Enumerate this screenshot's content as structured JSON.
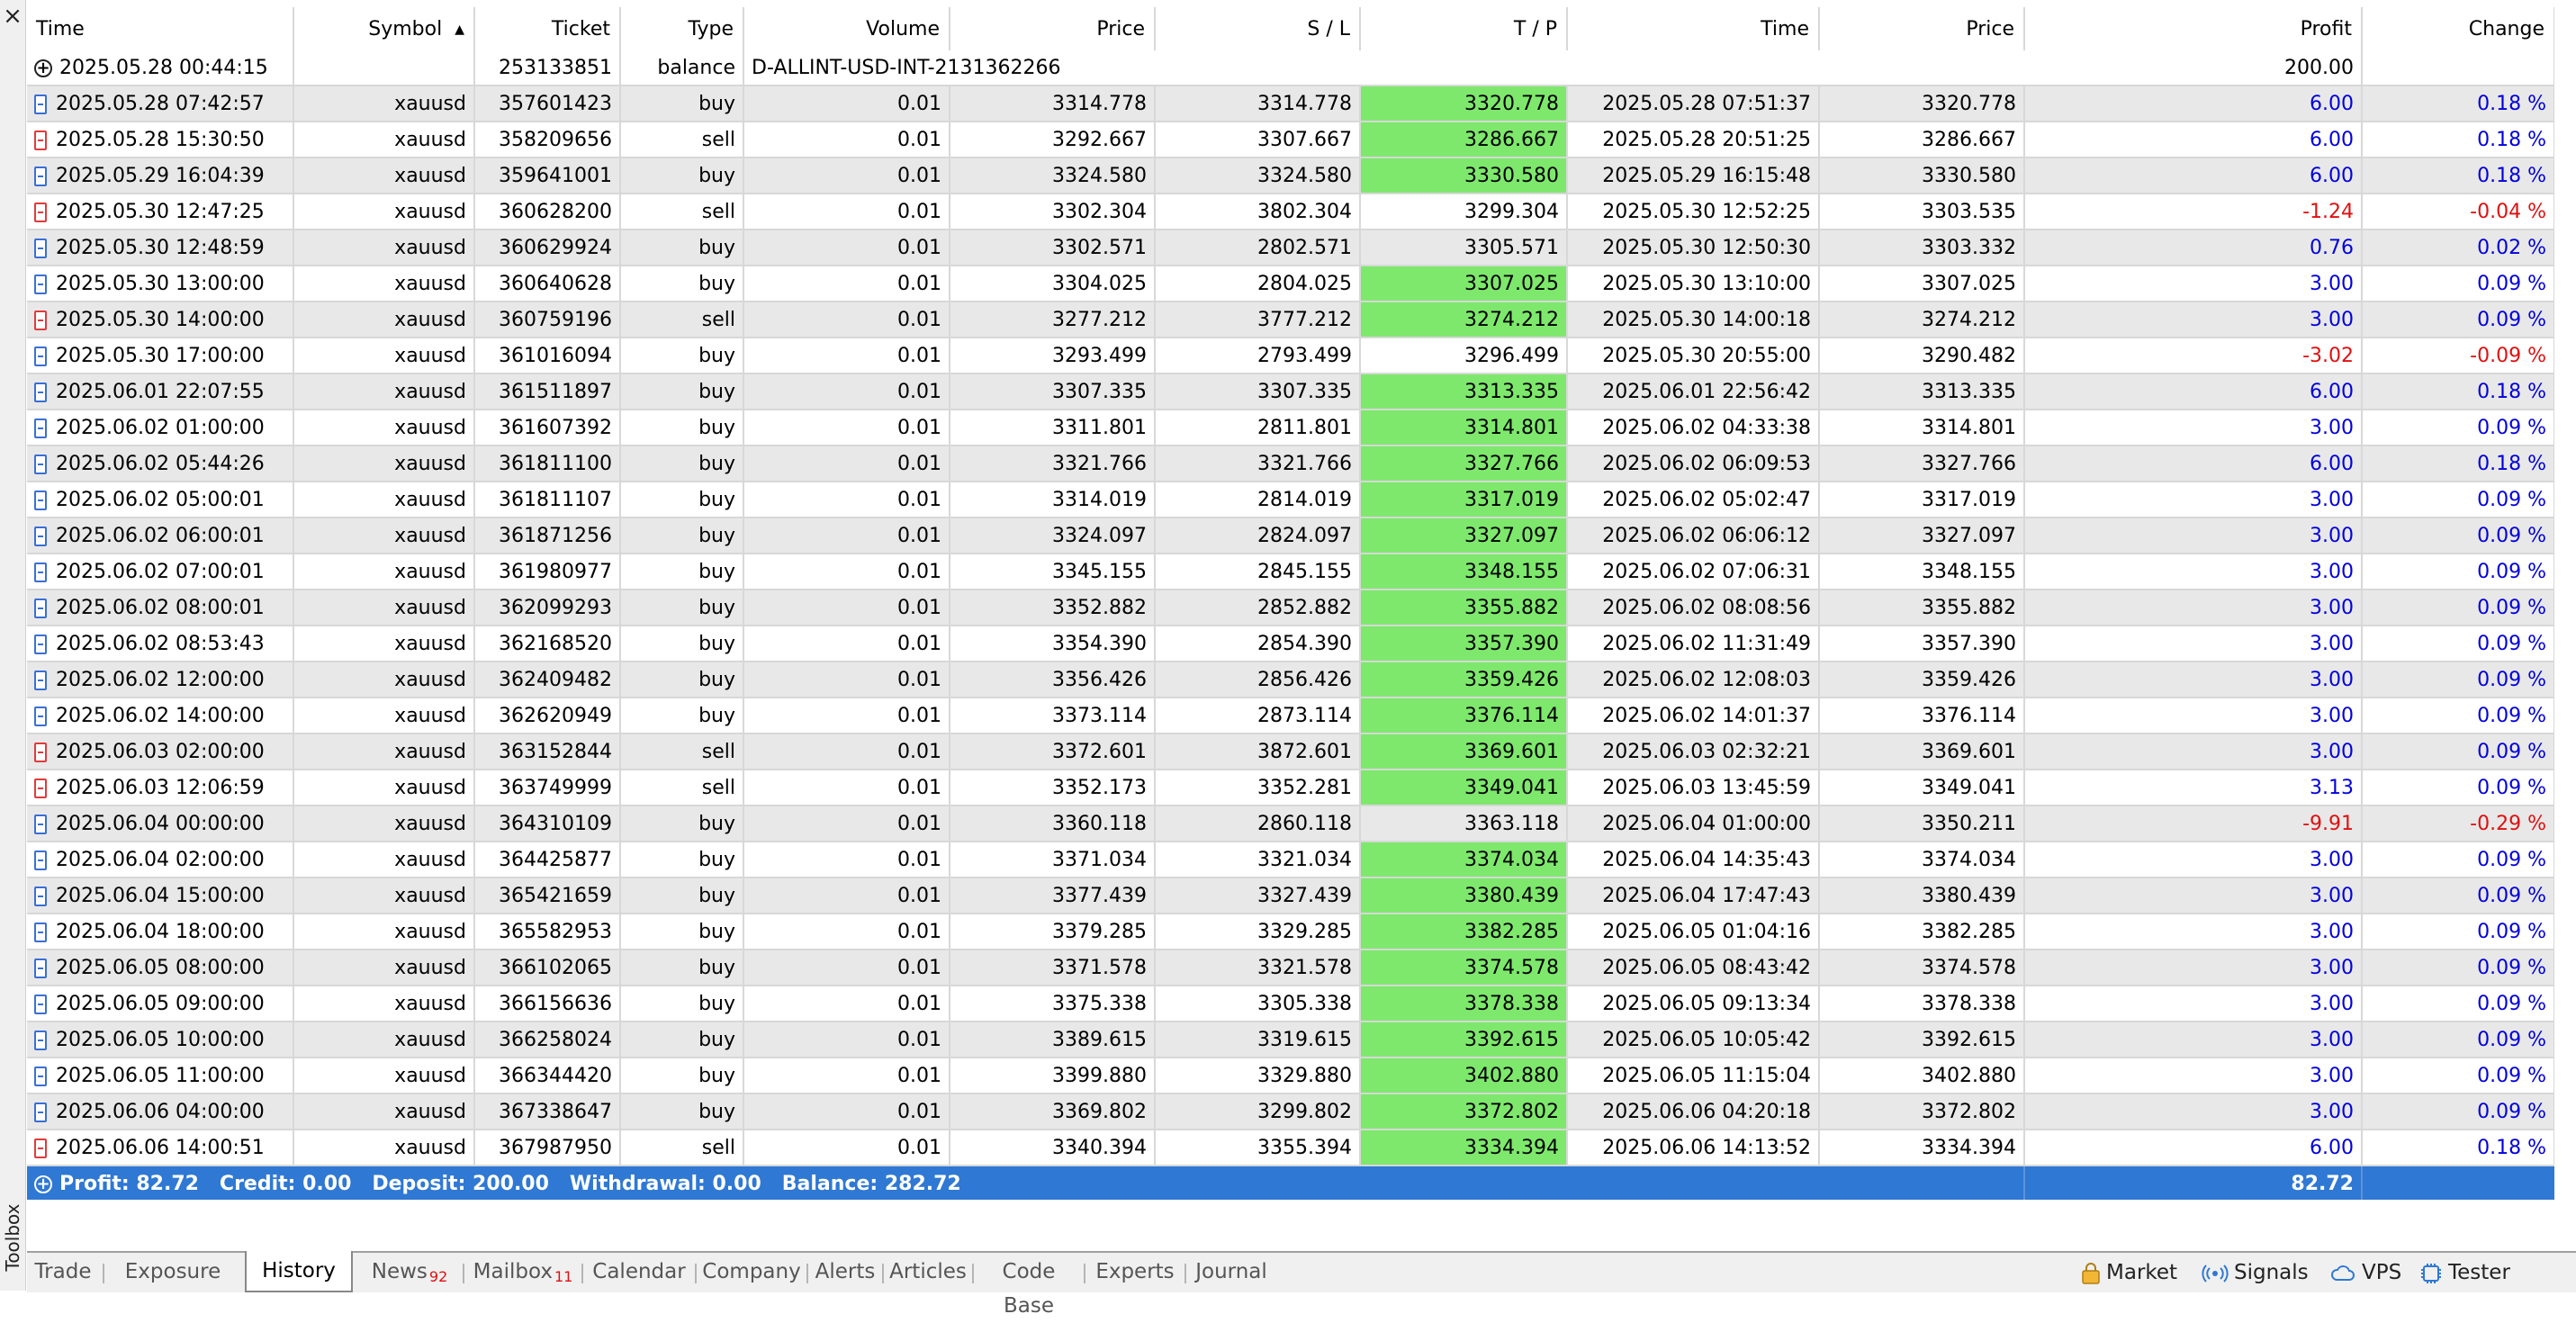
{
  "window": {
    "close_glyph": "×",
    "side_label": "Toolbox"
  },
  "columns": [
    "Time",
    "Symbol",
    "Ticket",
    "Type",
    "Volume",
    "Price",
    "S / L",
    "T / P",
    "Time",
    "Price",
    "Profit",
    "Change"
  ],
  "balance_row": {
    "time": "2025.05.28 00:44:15",
    "ticket": "253133851",
    "type": "balance",
    "comment": "D-ALLINT-USD-INT-2131362266",
    "profit": "200.00"
  },
  "rows": [
    {
      "time": "2025.05.28 07:42:57",
      "symbol": "xauusd",
      "ticket": "357601423",
      "type": "buy",
      "volume": "0.01",
      "price": "3314.778",
      "sl": "3314.778",
      "tp": "3320.778",
      "close_time": "2025.05.28 07:51:37",
      "close_price": "3320.778",
      "profit": "6.00",
      "change": "0.18 %"
    },
    {
      "time": "2025.05.28 15:30:50",
      "symbol": "xauusd",
      "ticket": "358209656",
      "type": "sell",
      "volume": "0.01",
      "price": "3292.667",
      "sl": "3307.667",
      "tp": "3286.667",
      "close_time": "2025.05.28 20:51:25",
      "close_price": "3286.667",
      "profit": "6.00",
      "change": "0.18 %"
    },
    {
      "time": "2025.05.29 16:04:39",
      "symbol": "xauusd",
      "ticket": "359641001",
      "type": "buy",
      "volume": "0.01",
      "price": "3324.580",
      "sl": "3324.580",
      "tp": "3330.580",
      "close_time": "2025.05.29 16:15:48",
      "close_price": "3330.580",
      "profit": "6.00",
      "change": "0.18 %"
    },
    {
      "time": "2025.05.30 12:47:25",
      "symbol": "xauusd",
      "ticket": "360628200",
      "type": "sell",
      "volume": "0.01",
      "price": "3302.304",
      "sl": "3802.304",
      "tp": "3299.304",
      "close_time": "2025.05.30 12:52:25",
      "close_price": "3303.535",
      "profit": "-1.24",
      "change": "-0.04 %"
    },
    {
      "time": "2025.05.30 12:48:59",
      "symbol": "xauusd",
      "ticket": "360629924",
      "type": "buy",
      "volume": "0.01",
      "price": "3302.571",
      "sl": "2802.571",
      "tp": "3305.571",
      "close_time": "2025.05.30 12:50:30",
      "close_price": "3303.332",
      "profit": "0.76",
      "change": "0.02 %"
    },
    {
      "time": "2025.05.30 13:00:00",
      "symbol": "xauusd",
      "ticket": "360640628",
      "type": "buy",
      "volume": "0.01",
      "price": "3304.025",
      "sl": "2804.025",
      "tp": "3307.025",
      "close_time": "2025.05.30 13:10:00",
      "close_price": "3307.025",
      "profit": "3.00",
      "change": "0.09 %"
    },
    {
      "time": "2025.05.30 14:00:00",
      "symbol": "xauusd",
      "ticket": "360759196",
      "type": "sell",
      "volume": "0.01",
      "price": "3277.212",
      "sl": "3777.212",
      "tp": "3274.212",
      "close_time": "2025.05.30 14:00:18",
      "close_price": "3274.212",
      "profit": "3.00",
      "change": "0.09 %"
    },
    {
      "time": "2025.05.30 17:00:00",
      "symbol": "xauusd",
      "ticket": "361016094",
      "type": "buy",
      "volume": "0.01",
      "price": "3293.499",
      "sl": "2793.499",
      "tp": "3296.499",
      "close_time": "2025.05.30 20:55:00",
      "close_price": "3290.482",
      "profit": "-3.02",
      "change": "-0.09 %"
    },
    {
      "time": "2025.06.01 22:07:55",
      "symbol": "xauusd",
      "ticket": "361511897",
      "type": "buy",
      "volume": "0.01",
      "price": "3307.335",
      "sl": "3307.335",
      "tp": "3313.335",
      "close_time": "2025.06.01 22:56:42",
      "close_price": "3313.335",
      "profit": "6.00",
      "change": "0.18 %"
    },
    {
      "time": "2025.06.02 01:00:00",
      "symbol": "xauusd",
      "ticket": "361607392",
      "type": "buy",
      "volume": "0.01",
      "price": "3311.801",
      "sl": "2811.801",
      "tp": "3314.801",
      "close_time": "2025.06.02 04:33:38",
      "close_price": "3314.801",
      "profit": "3.00",
      "change": "0.09 %"
    },
    {
      "time": "2025.06.02 05:44:26",
      "symbol": "xauusd",
      "ticket": "361811100",
      "type": "buy",
      "volume": "0.01",
      "price": "3321.766",
      "sl": "3321.766",
      "tp": "3327.766",
      "close_time": "2025.06.02 06:09:53",
      "close_price": "3327.766",
      "profit": "6.00",
      "change": "0.18 %"
    },
    {
      "time": "2025.06.02 05:00:01",
      "symbol": "xauusd",
      "ticket": "361811107",
      "type": "buy",
      "volume": "0.01",
      "price": "3314.019",
      "sl": "2814.019",
      "tp": "3317.019",
      "close_time": "2025.06.02 05:02:47",
      "close_price": "3317.019",
      "profit": "3.00",
      "change": "0.09 %"
    },
    {
      "time": "2025.06.02 06:00:01",
      "symbol": "xauusd",
      "ticket": "361871256",
      "type": "buy",
      "volume": "0.01",
      "price": "3324.097",
      "sl": "2824.097",
      "tp": "3327.097",
      "close_time": "2025.06.02 06:06:12",
      "close_price": "3327.097",
      "profit": "3.00",
      "change": "0.09 %"
    },
    {
      "time": "2025.06.02 07:00:01",
      "symbol": "xauusd",
      "ticket": "361980977",
      "type": "buy",
      "volume": "0.01",
      "price": "3345.155",
      "sl": "2845.155",
      "tp": "3348.155",
      "close_time": "2025.06.02 07:06:31",
      "close_price": "3348.155",
      "profit": "3.00",
      "change": "0.09 %"
    },
    {
      "time": "2025.06.02 08:00:01",
      "symbol": "xauusd",
      "ticket": "362099293",
      "type": "buy",
      "volume": "0.01",
      "price": "3352.882",
      "sl": "2852.882",
      "tp": "3355.882",
      "close_time": "2025.06.02 08:08:56",
      "close_price": "3355.882",
      "profit": "3.00",
      "change": "0.09 %"
    },
    {
      "time": "2025.06.02 08:53:43",
      "symbol": "xauusd",
      "ticket": "362168520",
      "type": "buy",
      "volume": "0.01",
      "price": "3354.390",
      "sl": "2854.390",
      "tp": "3357.390",
      "close_time": "2025.06.02 11:31:49",
      "close_price": "3357.390",
      "profit": "3.00",
      "change": "0.09 %"
    },
    {
      "time": "2025.06.02 12:00:00",
      "symbol": "xauusd",
      "ticket": "362409482",
      "type": "buy",
      "volume": "0.01",
      "price": "3356.426",
      "sl": "2856.426",
      "tp": "3359.426",
      "close_time": "2025.06.02 12:08:03",
      "close_price": "3359.426",
      "profit": "3.00",
      "change": "0.09 %"
    },
    {
      "time": "2025.06.02 14:00:00",
      "symbol": "xauusd",
      "ticket": "362620949",
      "type": "buy",
      "volume": "0.01",
      "price": "3373.114",
      "sl": "2873.114",
      "tp": "3376.114",
      "close_time": "2025.06.02 14:01:37",
      "close_price": "3376.114",
      "profit": "3.00",
      "change": "0.09 %"
    },
    {
      "time": "2025.06.03 02:00:00",
      "symbol": "xauusd",
      "ticket": "363152844",
      "type": "sell",
      "volume": "0.01",
      "price": "3372.601",
      "sl": "3872.601",
      "tp": "3369.601",
      "close_time": "2025.06.03 02:32:21",
      "close_price": "3369.601",
      "profit": "3.00",
      "change": "0.09 %"
    },
    {
      "time": "2025.06.03 12:06:59",
      "symbol": "xauusd",
      "ticket": "363749999",
      "type": "sell",
      "volume": "0.01",
      "price": "3352.173",
      "sl": "3352.281",
      "tp": "3349.041",
      "close_time": "2025.06.03 13:45:59",
      "close_price": "3349.041",
      "profit": "3.13",
      "change": "0.09 %"
    },
    {
      "time": "2025.06.04 00:00:00",
      "symbol": "xauusd",
      "ticket": "364310109",
      "type": "buy",
      "volume": "0.01",
      "price": "3360.118",
      "sl": "2860.118",
      "tp": "3363.118",
      "close_time": "2025.06.04 01:00:00",
      "close_price": "3350.211",
      "profit": "-9.91",
      "change": "-0.29 %"
    },
    {
      "time": "2025.06.04 02:00:00",
      "symbol": "xauusd",
      "ticket": "364425877",
      "type": "buy",
      "volume": "0.01",
      "price": "3371.034",
      "sl": "3321.034",
      "tp": "3374.034",
      "close_time": "2025.06.04 14:35:43",
      "close_price": "3374.034",
      "profit": "3.00",
      "change": "0.09 %"
    },
    {
      "time": "2025.06.04 15:00:00",
      "symbol": "xauusd",
      "ticket": "365421659",
      "type": "buy",
      "volume": "0.01",
      "price": "3377.439",
      "sl": "3327.439",
      "tp": "3380.439",
      "close_time": "2025.06.04 17:47:43",
      "close_price": "3380.439",
      "profit": "3.00",
      "change": "0.09 %"
    },
    {
      "time": "2025.06.04 18:00:00",
      "symbol": "xauusd",
      "ticket": "365582953",
      "type": "buy",
      "volume": "0.01",
      "price": "3379.285",
      "sl": "3329.285",
      "tp": "3382.285",
      "close_time": "2025.06.05 01:04:16",
      "close_price": "3382.285",
      "profit": "3.00",
      "change": "0.09 %"
    },
    {
      "time": "2025.06.05 08:00:00",
      "symbol": "xauusd",
      "ticket": "366102065",
      "type": "buy",
      "volume": "0.01",
      "price": "3371.578",
      "sl": "3321.578",
      "tp": "3374.578",
      "close_time": "2025.06.05 08:43:42",
      "close_price": "3374.578",
      "profit": "3.00",
      "change": "0.09 %"
    },
    {
      "time": "2025.06.05 09:00:00",
      "symbol": "xauusd",
      "ticket": "366156636",
      "type": "buy",
      "volume": "0.01",
      "price": "3375.338",
      "sl": "3305.338",
      "tp": "3378.338",
      "close_time": "2025.06.05 09:13:34",
      "close_price": "3378.338",
      "profit": "3.00",
      "change": "0.09 %"
    },
    {
      "time": "2025.06.05 10:00:00",
      "symbol": "xauusd",
      "ticket": "366258024",
      "type": "buy",
      "volume": "0.01",
      "price": "3389.615",
      "sl": "3319.615",
      "tp": "3392.615",
      "close_time": "2025.06.05 10:05:42",
      "close_price": "3392.615",
      "profit": "3.00",
      "change": "0.09 %"
    },
    {
      "time": "2025.06.05 11:00:00",
      "symbol": "xauusd",
      "ticket": "366344420",
      "type": "buy",
      "volume": "0.01",
      "price": "3399.880",
      "sl": "3329.880",
      "tp": "3402.880",
      "close_time": "2025.06.05 11:15:04",
      "close_price": "3402.880",
      "profit": "3.00",
      "change": "0.09 %"
    },
    {
      "time": "2025.06.06 04:00:00",
      "symbol": "xauusd",
      "ticket": "367338647",
      "type": "buy",
      "volume": "0.01",
      "price": "3369.802",
      "sl": "3299.802",
      "tp": "3372.802",
      "close_time": "2025.06.06 04:20:18",
      "close_price": "3372.802",
      "profit": "3.00",
      "change": "0.09 %"
    },
    {
      "time": "2025.06.06 14:00:51",
      "symbol": "xauusd",
      "ticket": "367987950",
      "type": "sell",
      "volume": "0.01",
      "price": "3340.394",
      "sl": "3355.394",
      "tp": "3334.394",
      "close_time": "2025.06.06 14:13:52",
      "close_price": "3334.394",
      "profit": "6.00",
      "change": "0.18 %"
    }
  ],
  "summary": {
    "text": "Profit: 82.72   Credit: 0.00   Deposit: 200.00   Withdrawal: 0.00   Balance: 282.72",
    "profit": "82.72"
  },
  "tabs": [
    {
      "label": "Trade",
      "badge": ""
    },
    {
      "label": "Exposure",
      "badge": ""
    },
    {
      "label": "History",
      "badge": "",
      "active": true
    },
    {
      "label": "News",
      "badge": "92"
    },
    {
      "label": "Mailbox",
      "badge": "11"
    },
    {
      "label": "Calendar",
      "badge": ""
    },
    {
      "label": "Company",
      "badge": ""
    },
    {
      "label": "Alerts",
      "badge": ""
    },
    {
      "label": "Articles",
      "badge": ""
    },
    {
      "label": "Code Base",
      "badge": ""
    },
    {
      "label": "Experts",
      "badge": ""
    },
    {
      "label": "Journal",
      "badge": ""
    }
  ],
  "right_tools": [
    {
      "label": "Market",
      "icon": "lock-bag-icon"
    },
    {
      "label": "Signals",
      "icon": "signal-icon"
    },
    {
      "label": "VPS",
      "icon": "cloud-icon"
    },
    {
      "label": "Tester",
      "icon": "chip-icon"
    }
  ],
  "colors": {
    "tp_hit": "#7ee86c",
    "profit_positive": "#0000dd",
    "profit_negative": "#e01010",
    "summary_bar": "#2f78d3",
    "buy_icon": "#3a6fd6",
    "sell_icon": "#e03b3b"
  }
}
